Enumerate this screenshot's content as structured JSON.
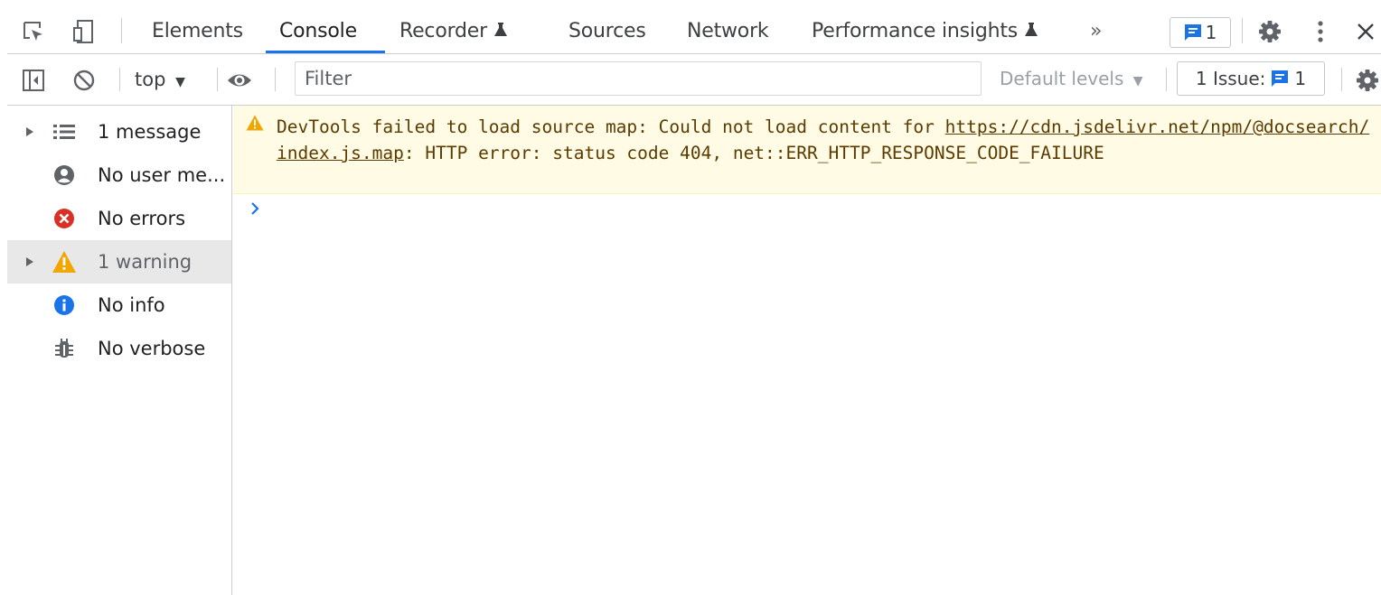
{
  "tabs": [
    {
      "label": "Elements"
    },
    {
      "label": "Console"
    },
    {
      "label": "Recorder"
    },
    {
      "label": "Sources"
    },
    {
      "label": "Network"
    },
    {
      "label": "Performance insights"
    }
  ],
  "issue_badge_count": "1",
  "toolbar": {
    "context": "top",
    "filter_placeholder": "Filter",
    "levels_label": "Default levels",
    "issues_label": "1 Issue:",
    "issues_count": "1"
  },
  "sidebar": {
    "items": [
      {
        "label": "1 message",
        "icon": "list-icon"
      },
      {
        "label": "No user me...",
        "icon": "user-icon"
      },
      {
        "label": "No errors",
        "icon": "error-icon"
      },
      {
        "label": "1 warning",
        "icon": "warning-icon"
      },
      {
        "label": "No info",
        "icon": "info-icon"
      },
      {
        "label": "No verbose",
        "icon": "bug-icon"
      }
    ]
  },
  "console": {
    "warning": {
      "prefix": "DevTools failed to load source map: Could not load content for ",
      "url": "https://cdn.jsdelivr.net/npm/@docsearch/index.js.map",
      "suffix": ": HTTP error: status code 404, net::ERR_HTTP_RESPONSE_CODE_FAILURE"
    }
  },
  "colors": {
    "accent": "#1a73e8",
    "warning_bg": "#fffbe5",
    "warning_text": "#5c3b00",
    "warning_icon": "#f2a600",
    "error_icon": "#d93025"
  }
}
